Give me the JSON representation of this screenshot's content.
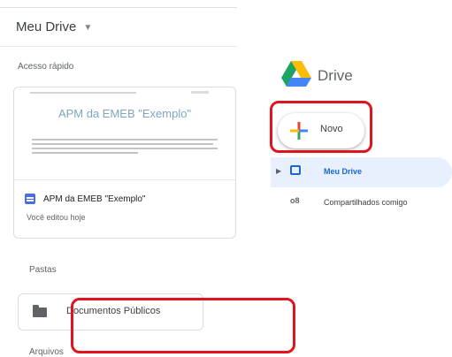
{
  "left_panel": {
    "title": "Meu Drive",
    "quick_access_label": "Acesso rápido",
    "quick_card": {
      "preview_title": "APM da EMEB \"Exemplo\"",
      "doc_name": "APM da EMEB \"Exemplo\"",
      "doc_subtitle": "Você editou hoje"
    },
    "folders_label": "Pastas",
    "folder_name": "Documentos Públicos",
    "files_label": "Arquivos"
  },
  "right_panel": {
    "logo_text": "Drive",
    "new_button_label": "Novo",
    "nav": {
      "my_drive": "Meu Drive",
      "shared_with_me": "Compartilhados comigo"
    }
  },
  "colors": {
    "highlight_red": "#e0141e",
    "nav_active_bg": "#e8f0fe",
    "nav_active_text": "#1967d2"
  },
  "icons": [
    "chevron-down-icon",
    "google-docs-icon",
    "folder-icon",
    "google-drive-logo",
    "plus-icon",
    "expand-arrow-icon",
    "my-drive-icon",
    "shared-icon"
  ]
}
